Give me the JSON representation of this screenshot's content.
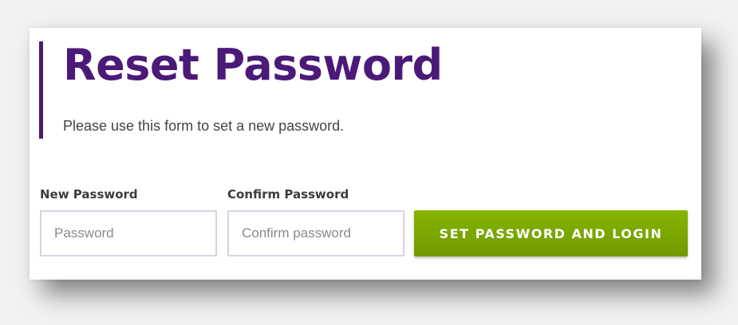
{
  "form": {
    "title": "Reset Password",
    "subtitle": "Please use this form to set a new password.",
    "new_password": {
      "label": "New Password",
      "placeholder": "Password",
      "value": ""
    },
    "confirm_password": {
      "label": "Confirm Password",
      "placeholder": "Confirm password",
      "value": ""
    },
    "submit_label": "SET PASSWORD AND LOGIN"
  },
  "colors": {
    "title": "#4b1a78",
    "accent_bar": "#4a1a72",
    "button": "#7aa800",
    "input_border": "#d8d2e4"
  }
}
